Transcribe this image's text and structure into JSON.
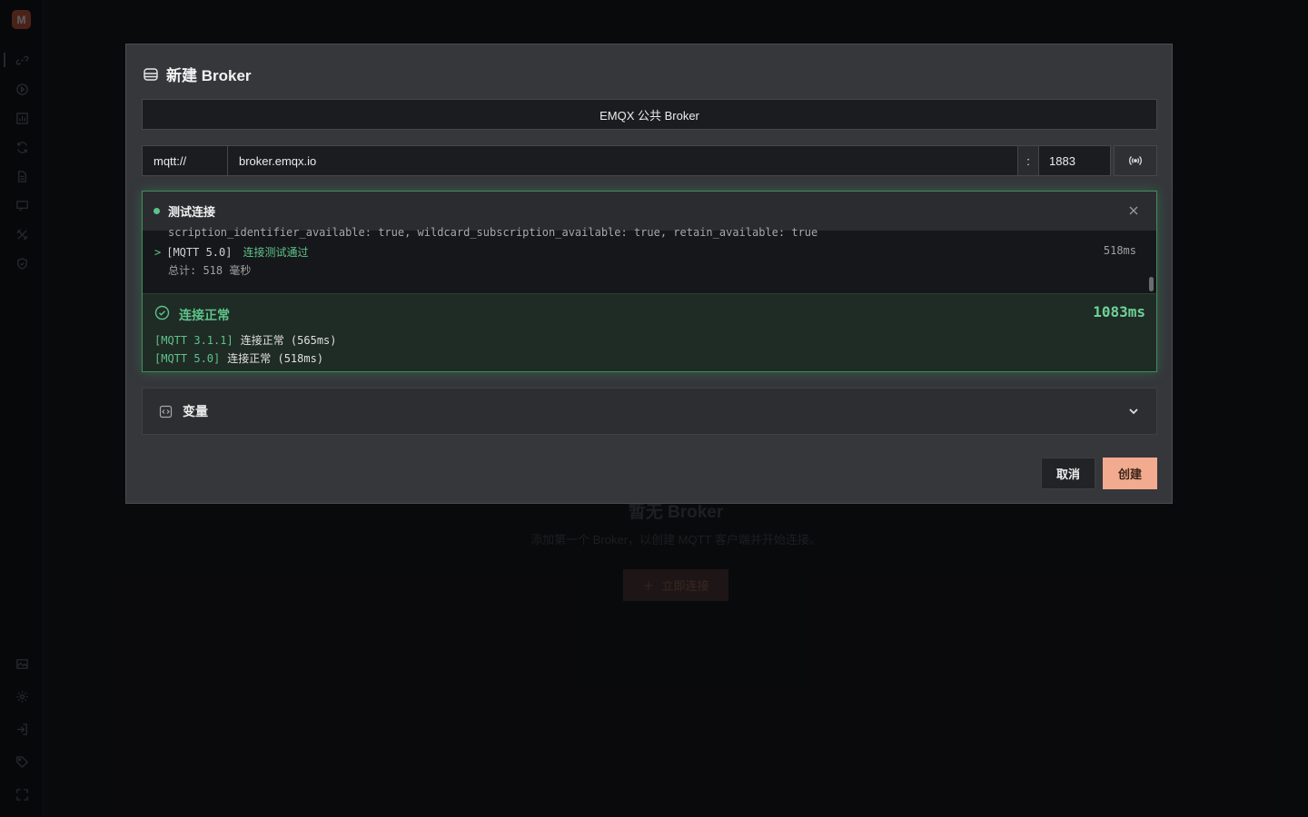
{
  "sidebar": {
    "logo": "M",
    "icons": [
      "link-icon",
      "play-circle-icon",
      "chart-icon",
      "refresh-icon",
      "document-icon",
      "message-icon",
      "tools-icon",
      "shield-icon",
      "image-icon",
      "gear-icon",
      "login-icon",
      "tag-icon",
      "expand-icon"
    ]
  },
  "background": {
    "empty_title": "暂无 Broker",
    "empty_desc": "添加第一个 Broker，以创建 MQTT 客户端并开始连接。",
    "connect_button": "立即连接"
  },
  "modal": {
    "title": "新建 Broker",
    "preset": "EMQX 公共 Broker",
    "protocol": "mqtt://",
    "host": "broker.emqx.io",
    "colon": ":",
    "port": "1883"
  },
  "test": {
    "title": "测试连接",
    "log_cut_line": "scription_identifier_available: true, wildcard_subscription_available: true, retain_available: true",
    "log_prompt": ">",
    "log_tag": "[MQTT 5.0]",
    "log_pass": "连接测试通过",
    "log_time": "518ms",
    "log_total": "总计: 518 毫秒",
    "result_title": "连接正常",
    "result_total": "1083ms",
    "results": [
      {
        "tag": "[MQTT 3.1.1]",
        "text": "连接正常 (565ms)"
      },
      {
        "tag": "[MQTT 5.0]",
        "text": "连接正常 (518ms)"
      }
    ],
    "status_color": "#5ec28a"
  },
  "variables": {
    "label": "变量"
  },
  "footer": {
    "cancel": "取消",
    "create": "创建",
    "accent": "#f2ab8e"
  }
}
